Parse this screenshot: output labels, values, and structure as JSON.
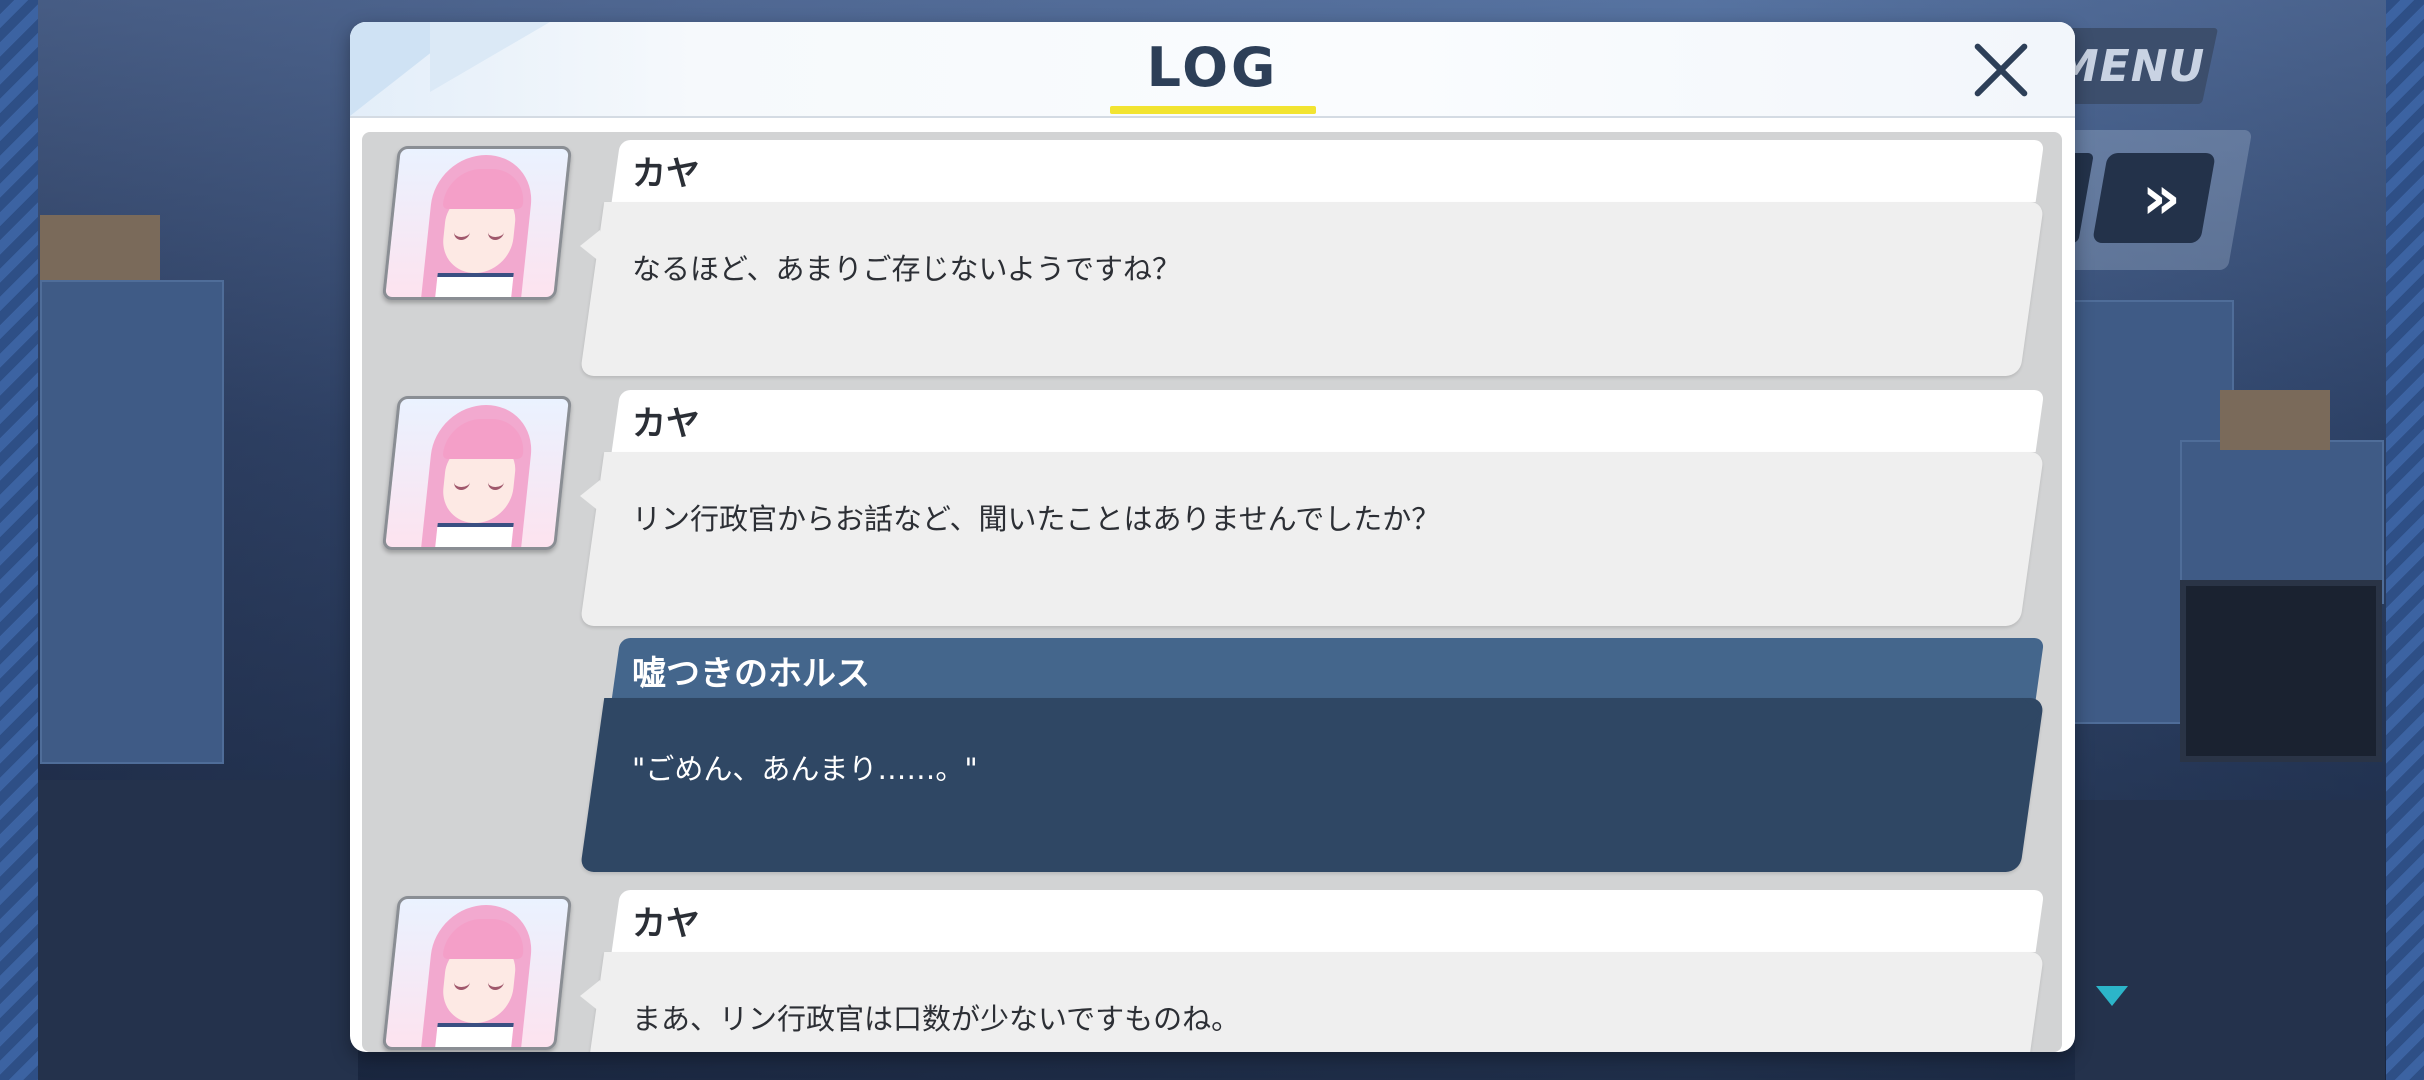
{
  "hud": {
    "menu_label": "MENU",
    "fast_forward_glyph": "»"
  },
  "log": {
    "title": "LOG",
    "close_glyph": "×",
    "entries": [
      {
        "speaker": "カヤ",
        "text": "なるほど、あまりご存じないようですね？",
        "type": "npc"
      },
      {
        "speaker": "カヤ",
        "text": "リン行政官からお話など、聞いたことはありませんでしたか？",
        "type": "npc"
      },
      {
        "speaker": "嘘つきのホルス",
        "text": "\"ごめん、あんまり……。\"",
        "type": "player"
      },
      {
        "speaker": "カヤ",
        "text": "まあ、リン行政官は口数が少ないですものね。",
        "type": "npc"
      }
    ]
  },
  "colors": {
    "accent_underline": "#f2e431",
    "player_name_bg": "#44668c",
    "player_msg_bg": "#2f4764",
    "scroll_indicator": "#2cb5c9"
  },
  "icons": [
    "close-icon",
    "fast-forward-icon",
    "scroll-down-indicator-icon"
  ]
}
